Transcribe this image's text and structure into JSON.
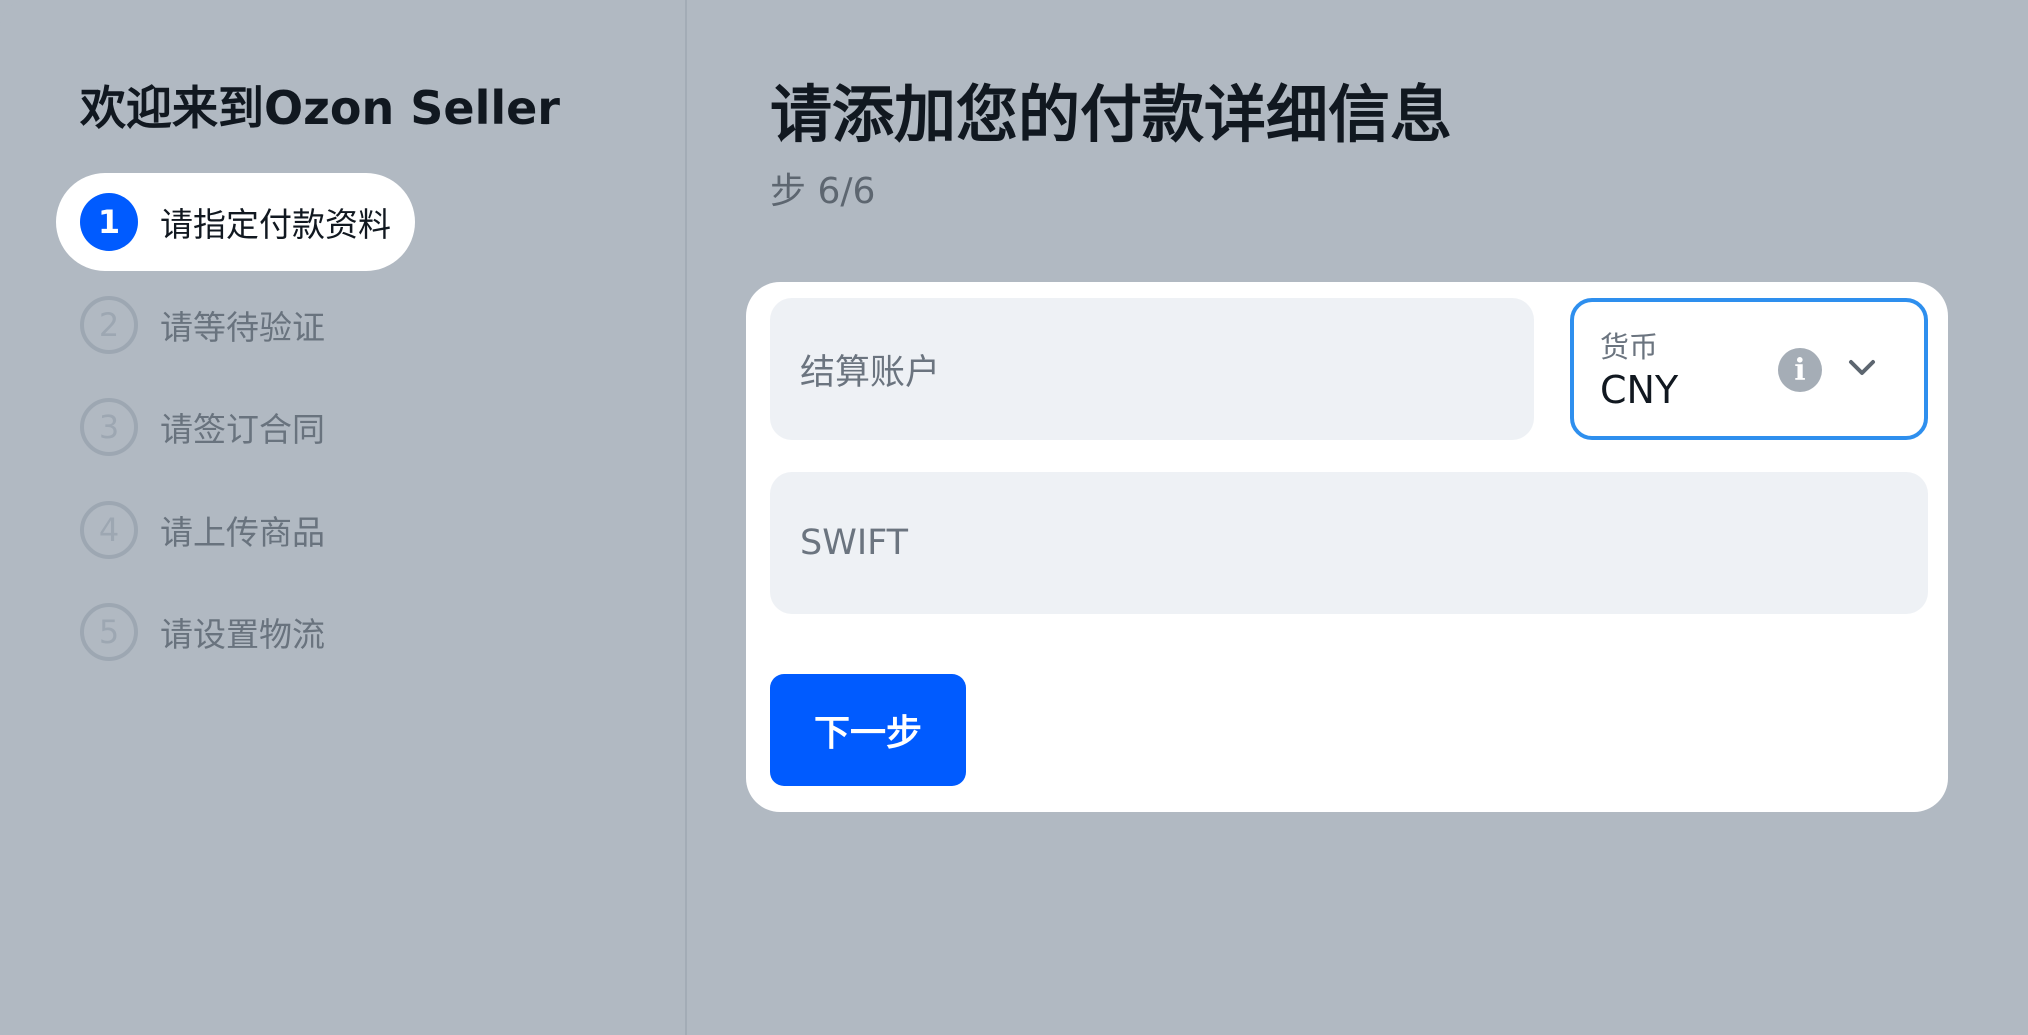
{
  "sidebar": {
    "title": "欢迎来到Ozon Seller",
    "steps": [
      {
        "number": "1",
        "label": "请指定付款资料",
        "state": "active"
      },
      {
        "number": "2",
        "label": "请等待验证",
        "state": "inactive"
      },
      {
        "number": "3",
        "label": "请签订合同",
        "state": "inactive"
      },
      {
        "number": "4",
        "label": "请上传商品",
        "state": "inactive"
      },
      {
        "number": "5",
        "label": "请设置物流",
        "state": "inactive"
      }
    ]
  },
  "main": {
    "title": "请添加您的付款详细信息",
    "step_counter": "步 6/6",
    "form": {
      "account_placeholder": "结算账户",
      "currency": {
        "label": "货币",
        "value": "CNY",
        "info_icon": "info-icon",
        "dropdown_icon": "chevron-down-icon"
      },
      "swift_placeholder": "SWIFT",
      "next_button": "下一步"
    }
  },
  "colors": {
    "background": "#b1b9c2",
    "accent": "#005bff",
    "focus_border": "#2e8fee",
    "field_bg": "#eef1f5"
  }
}
